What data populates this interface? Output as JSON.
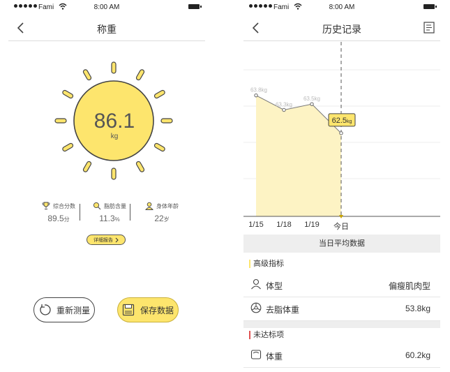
{
  "status_bar": {
    "carrier": "Fami",
    "time": "8:00 AM"
  },
  "weigh_screen": {
    "title": "称重",
    "weight": {
      "value": "86.1",
      "unit": "kg"
    },
    "stats": [
      {
        "label": "综合分数",
        "value": "89.5",
        "unit": "分",
        "icon": "trophy-icon"
      },
      {
        "label": "脂肪含量",
        "value": "11.3",
        "unit": "%",
        "icon": "fat-drop-icon"
      },
      {
        "label": "身体年龄",
        "value": "22",
        "unit": "岁",
        "icon": "person-icon"
      }
    ],
    "report_button": "详细报告",
    "remeasure_button": "重新测量",
    "save_button": "保存数据",
    "colors": {
      "accent": "#fde56d",
      "sun_stroke": "#444444"
    }
  },
  "history_screen": {
    "title": "历史记录",
    "today_label": "今日",
    "daily_average": "当日平均数据",
    "advanced_section": "高级指标",
    "advanced_rows": [
      {
        "label": "体型",
        "value": "偏瘦肌肉型",
        "icon": "person-outline-icon"
      },
      {
        "label": "去脂体重",
        "value": "53.8kg",
        "icon": "scale-dial-icon"
      }
    ],
    "unmet_section": "未达标项",
    "unmet_rows": [
      {
        "label": "体重",
        "value": "60.2kg",
        "icon": "scale-icon"
      }
    ],
    "colors": {
      "accent": "#fde56d",
      "alert": "#e05252"
    }
  },
  "chart_data": {
    "type": "area",
    "categories": [
      "1/15",
      "1/18",
      "1/19",
      "今日"
    ],
    "series": [
      {
        "values": [
          63.8,
          63.3,
          63.5,
          62.5
        ],
        "labels": [
          "63.8kg",
          "63.3kg",
          "63.5kg",
          "62.5kg"
        ]
      }
    ],
    "highlight_index": 3,
    "ylim": [
      60,
      66
    ],
    "grid": true
  }
}
